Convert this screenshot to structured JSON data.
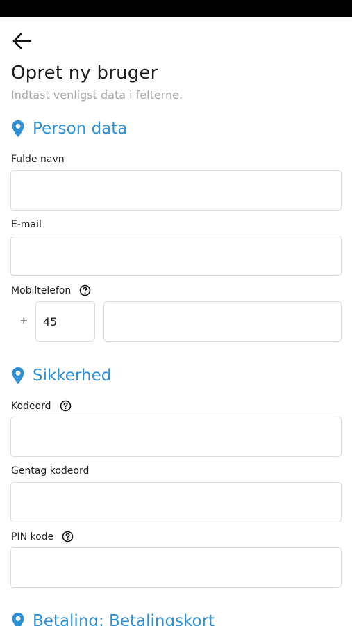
{
  "header": {
    "back_icon": "arrow-left-icon",
    "title": "Opret ny bruger",
    "subtitle": "Indtast venligst data i felterne."
  },
  "colors": {
    "accent": "#2d8fd6",
    "subtitle": "#a8a8a8",
    "input_border": "#dcdcdc",
    "status_bar": "#000000"
  },
  "sections": {
    "person": {
      "icon": "location-pin-icon",
      "title": "Person data",
      "full_name_label": "Fulde navn",
      "full_name_value": "",
      "email_label": "E-mail",
      "email_value": "",
      "phone_label": "Mobiltelefon",
      "phone_help_icon": "help-circle-icon",
      "phone_prefix": "+",
      "country_code_value": "45",
      "phone_value": ""
    },
    "security": {
      "icon": "location-pin-icon",
      "title": "Sikkerhed",
      "password_label": "Kodeord",
      "password_help_icon": "help-circle-icon",
      "password_value": "",
      "repeat_password_label": "Gentag kodeord",
      "repeat_password_value": "",
      "pin_label": "PIN kode",
      "pin_help_icon": "help-circle-icon",
      "pin_value": ""
    },
    "payment": {
      "icon": "location-pin-icon",
      "title": "Betaling: Betalingskort"
    }
  }
}
